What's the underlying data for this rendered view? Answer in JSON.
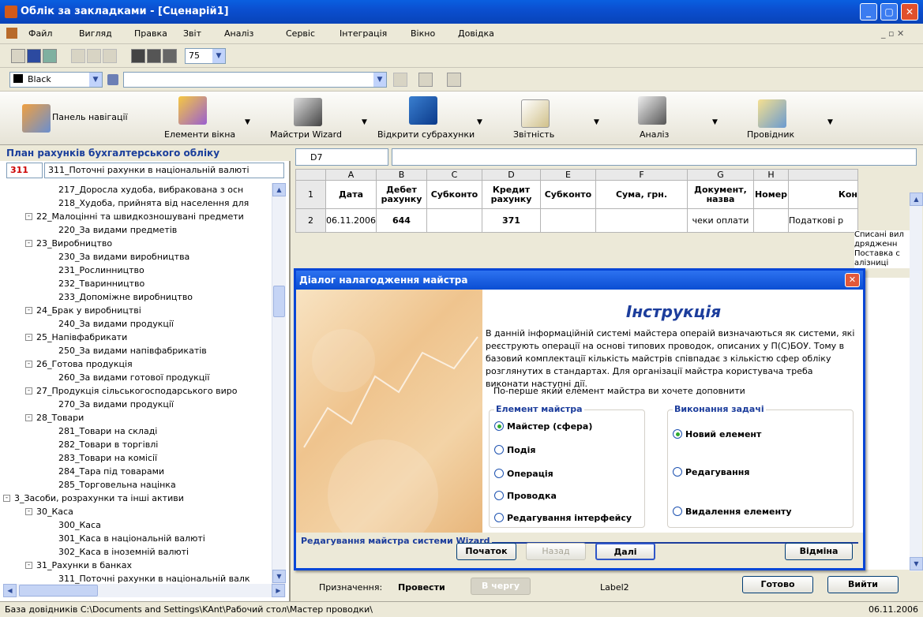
{
  "window": {
    "title": "Облік за закладками - [Сценарій1]",
    "min": "_",
    "max": "▢",
    "close": "✕"
  },
  "menu": [
    "Файл",
    "Вигляд",
    "Правка",
    "Звіт",
    "Аналіз",
    "Сервіс",
    "Інтеграція",
    "Вікно",
    "Довідка"
  ],
  "menu_right": "_ ▫ ✕",
  "toolbar": {
    "zoom": "75",
    "color_combo": "Black",
    "style_combo": ""
  },
  "bigbar": [
    {
      "label": "Панель навігації",
      "icon": "navigation-panel-icon"
    },
    {
      "label": "Елементи вікна",
      "icon": "window-elements-icon"
    },
    {
      "label": "Майстри Wizard",
      "icon": "wizard-icon"
    },
    {
      "label": "Відкрити субрахунки",
      "icon": "open-subaccounts-icon"
    },
    {
      "label": "Звітність",
      "icon": "reports-icon"
    },
    {
      "label": "Аналіз",
      "icon": "analysis-icon"
    },
    {
      "label": "Провідник",
      "icon": "explorer-icon"
    }
  ],
  "leftpanel": {
    "title": "План рахунків бухгалтерського обліку",
    "code": "311",
    "name": "311_Поточні рахунки в національній валюті",
    "tree": [
      {
        "text": "217_Доросла худоба, вибракована з осн",
        "level": 3
      },
      {
        "text": "218_Худоба, прийнята від населення для",
        "level": 3
      },
      {
        "text": "22_Малоцінні та швидкозношувані предмети",
        "level": 2,
        "toggle": "-"
      },
      {
        "text": "220_За видами предметів",
        "level": 3
      },
      {
        "text": "23_Виробництво",
        "level": 2,
        "toggle": "-"
      },
      {
        "text": "230_За видами виробництва",
        "level": 3
      },
      {
        "text": "231_Рослинництво",
        "level": 3
      },
      {
        "text": "232_Тваринництво",
        "level": 3
      },
      {
        "text": "233_Допоміжне виробництво",
        "level": 3
      },
      {
        "text": "24_Брак у виробництві",
        "level": 2,
        "toggle": "-"
      },
      {
        "text": "240_За видами продукції",
        "level": 3
      },
      {
        "text": "25_Напівфабрикати",
        "level": 2,
        "toggle": "-"
      },
      {
        "text": "250_За видами напівфабрикатів",
        "level": 3
      },
      {
        "text": "26_Готова продукція",
        "level": 2,
        "toggle": "-"
      },
      {
        "text": "260_За видами готової продукції",
        "level": 3
      },
      {
        "text": "27_Продукція сільськогосподарського виро",
        "level": 2,
        "toggle": "-"
      },
      {
        "text": "270_За видами продукції",
        "level": 3
      },
      {
        "text": "28_Товари",
        "level": 2,
        "toggle": "-"
      },
      {
        "text": "281_Товари на складі",
        "level": 3
      },
      {
        "text": "282_Товари в торгівлі",
        "level": 3
      },
      {
        "text": "283_Товари на комісії",
        "level": 3
      },
      {
        "text": "284_Тара під товарами",
        "level": 3
      },
      {
        "text": "285_Торговельна націнка",
        "level": 3
      },
      {
        "text": "3_Засоби, розрахунки та інші активи",
        "level": 1,
        "toggle": "-"
      },
      {
        "text": "30_Каса",
        "level": 2,
        "toggle": "-"
      },
      {
        "text": "300_Каса",
        "level": 3
      },
      {
        "text": "301_Каса в національній валюті",
        "level": 3
      },
      {
        "text": "302_Каса в іноземній валюті",
        "level": 3
      },
      {
        "text": "31_Рахунки в банках",
        "level": 2,
        "toggle": "-"
      },
      {
        "text": "311_Поточні рахунки в національній валк",
        "level": 3
      }
    ]
  },
  "sheet": {
    "cell": "D7",
    "cols": [
      "A",
      "B",
      "C",
      "D",
      "E",
      "F",
      "G",
      "H",
      ""
    ],
    "headers": [
      "Дата",
      "Дебет рахунку",
      "Субконто",
      "Кредит рахунку",
      "Субконто",
      "Сума, грн.",
      "Документ, назва",
      "Номер",
      "Кон"
    ],
    "row2": [
      "06.11.2006",
      "644",
      "",
      "371",
      "",
      "",
      "чеки оплати",
      "",
      "Податкові р"
    ],
    "right_text": [
      "Списані вил",
      "дрядженн",
      "Поставка с",
      "алізниці"
    ]
  },
  "dialog": {
    "title": "Діалог налагодження майстра",
    "heading": "Інструкція",
    "text": "В данній інформаційній системі майстера операій визначаються як системи, які реєструють операції на основі типових проводок, описаних у П(С)БОУ. Тому в базовий комплектації кількість майстрів співпадає з кількістю сфер обліку розглянутих в стандартах. Для організації майстра користувача треба виконати наступні дії.",
    "question": "По-перше який елемент майстра ви хочете доповнити",
    "group1": {
      "label": "Елемент майстра",
      "options": [
        "Майстер (сфера)",
        "Подія",
        "Операція",
        "Проводка",
        "Редагування інтерфейсу"
      ],
      "selected": 0
    },
    "group2": {
      "label": "Виконання задачі",
      "options": [
        "Новий елемент",
        "Редагування",
        "Видалення елементу"
      ],
      "selected": 0
    },
    "footer_label": "Редагування майстра системи Wizard",
    "buttons": {
      "start": "Початок",
      "back": "Назад",
      "next": "Далі",
      "cancel": "Відміна"
    }
  },
  "bottom": {
    "purpose_label": "Призначення:",
    "run": "Провести",
    "queue": "В чергу",
    "label2": "Label2",
    "done": "Готово",
    "exit": "Вийти"
  },
  "status": {
    "text": "База довідників  C:\\Documents and Settings\\KAnt\\Рабочий стол\\Мастер проводки\\",
    "date": "06.11.2006"
  }
}
